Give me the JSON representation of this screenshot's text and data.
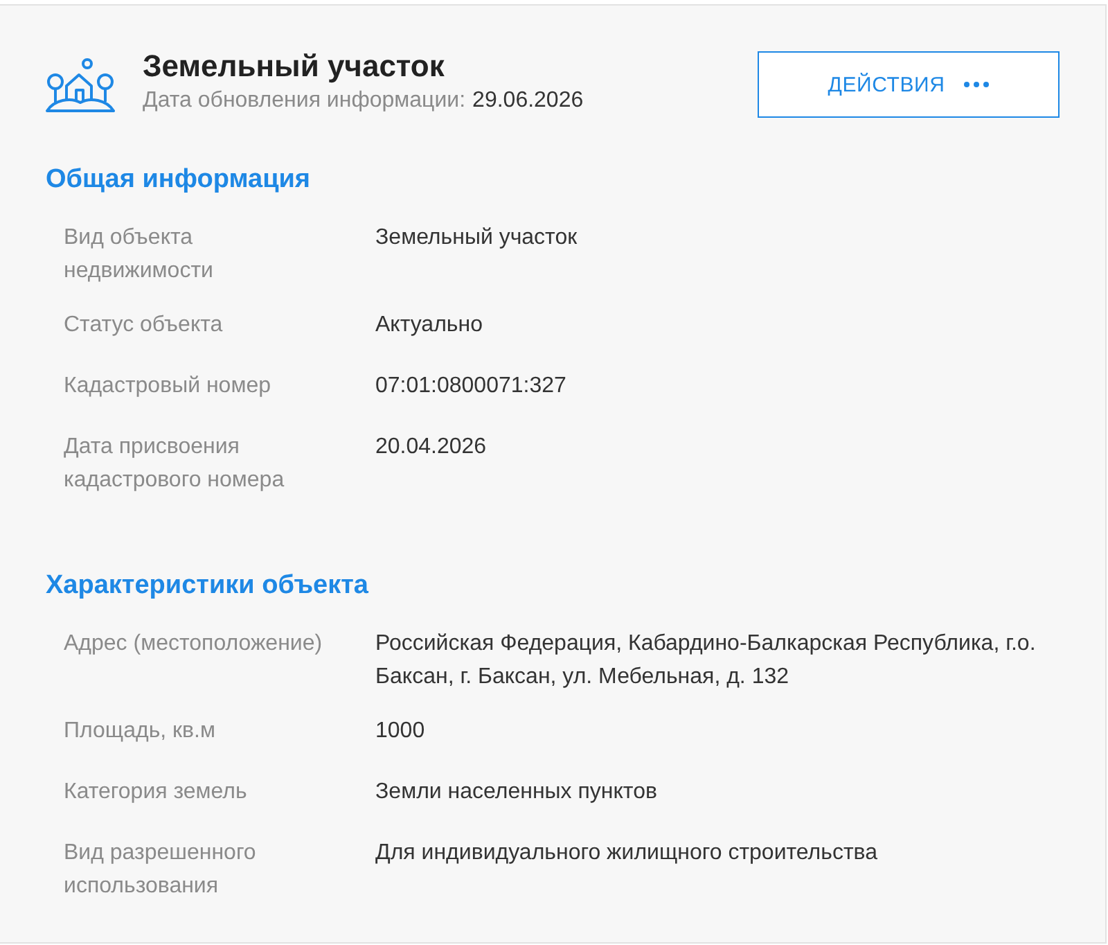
{
  "header": {
    "title": "Земельный участок",
    "updated_label": "Дата обновления информации:",
    "updated_date": "29.06.2026",
    "actions_button": {
      "label": "ДЕЙСТВИЯ"
    }
  },
  "sections": [
    {
      "title": "Общая информация",
      "rows": [
        {
          "label": "Вид объекта недвижимости",
          "value": "Земельный участок"
        },
        {
          "label": "Статус объекта",
          "value": "Актуально"
        },
        {
          "label": "Кадастровый номер",
          "value": "07:01:0800071:327"
        },
        {
          "label": "Дата присвоения кадастрового номера",
          "value": "20.04.2026"
        }
      ]
    },
    {
      "title": "Характеристики объекта",
      "rows": [
        {
          "label": "Адрес (местоположение)",
          "value": "Российская Федерация, Кабардино-Балкарская Республика, г.о. Баксан, г. Баксан, ул. Мебельная, д. 132"
        },
        {
          "label": "Площадь, кв.м",
          "value": "1000"
        },
        {
          "label": "Категория земель",
          "value": "Земли населенных пунктов"
        },
        {
          "label": "Вид разрешенного использования",
          "value": "Для индивидуального жилищного строительства"
        }
      ]
    }
  ]
}
